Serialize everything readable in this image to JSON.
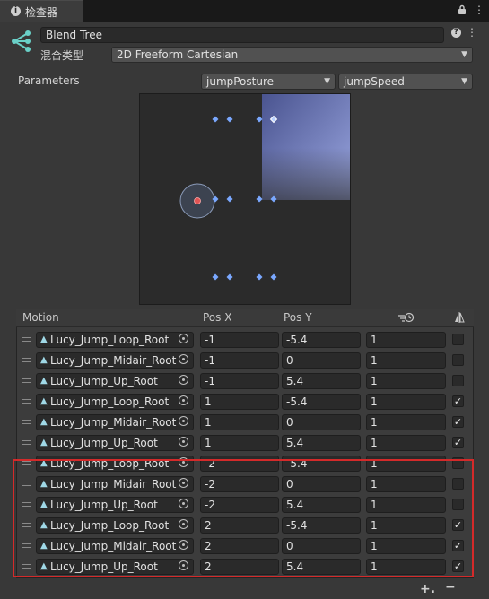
{
  "tab": {
    "title": "检查器",
    "info_icon": "i"
  },
  "header": {
    "name": "Blend Tree",
    "blend_type_label": "混合类型",
    "blend_type_value": "2D Freeform Cartesian",
    "help_icon": "?"
  },
  "parameters": {
    "label": "Parameters",
    "x_param": "jumpPosture",
    "y_param": "jumpSpeed"
  },
  "graph": {
    "highlight_color": "#8b97d4",
    "sample_color": "#7aa8ff",
    "current_color": "#e05555",
    "current_point": {
      "x": -2,
      "y": 0
    }
  },
  "columns": {
    "motion": "Motion",
    "pos_x": "Pos X",
    "pos_y": "Pos Y"
  },
  "rows": [
    {
      "clip": "Lucy_Jump_Loop_Root",
      "x": "-1",
      "y": "-5.4",
      "t": "1",
      "mirror": false
    },
    {
      "clip": "Lucy_Jump_Midair_Root",
      "x": "-1",
      "y": "0",
      "t": "1",
      "mirror": false
    },
    {
      "clip": "Lucy_Jump_Up_Root",
      "x": "-1",
      "y": "5.4",
      "t": "1",
      "mirror": false
    },
    {
      "clip": "Lucy_Jump_Loop_Root",
      "x": "1",
      "y": "-5.4",
      "t": "1",
      "mirror": true
    },
    {
      "clip": "Lucy_Jump_Midair_Root",
      "x": "1",
      "y": "0",
      "t": "1",
      "mirror": true
    },
    {
      "clip": "Lucy_Jump_Up_Root",
      "x": "1",
      "y": "5.4",
      "t": "1",
      "mirror": true
    },
    {
      "clip": "Lucy_Jump_Loop_Root",
      "x": "-2",
      "y": "-5.4",
      "t": "1",
      "mirror": false
    },
    {
      "clip": "Lucy_Jump_Midair_Root",
      "x": "-2",
      "y": "0",
      "t": "1",
      "mirror": false
    },
    {
      "clip": "Lucy_Jump_Up_Root",
      "x": "-2",
      "y": "5.4",
      "t": "1",
      "mirror": false
    },
    {
      "clip": "Lucy_Jump_Loop_Root",
      "x": "2",
      "y": "-5.4",
      "t": "1",
      "mirror": true
    },
    {
      "clip": "Lucy_Jump_Midair_Root",
      "x": "2",
      "y": "0",
      "t": "1",
      "mirror": true
    },
    {
      "clip": "Lucy_Jump_Up_Root",
      "x": "2",
      "y": "5.4",
      "t": "1",
      "mirror": true
    }
  ],
  "footer": {
    "add_label": "+.",
    "remove_label": "−"
  },
  "colors": {
    "highlight_box": "#d42a2a",
    "accent": "#7aa8ff"
  }
}
